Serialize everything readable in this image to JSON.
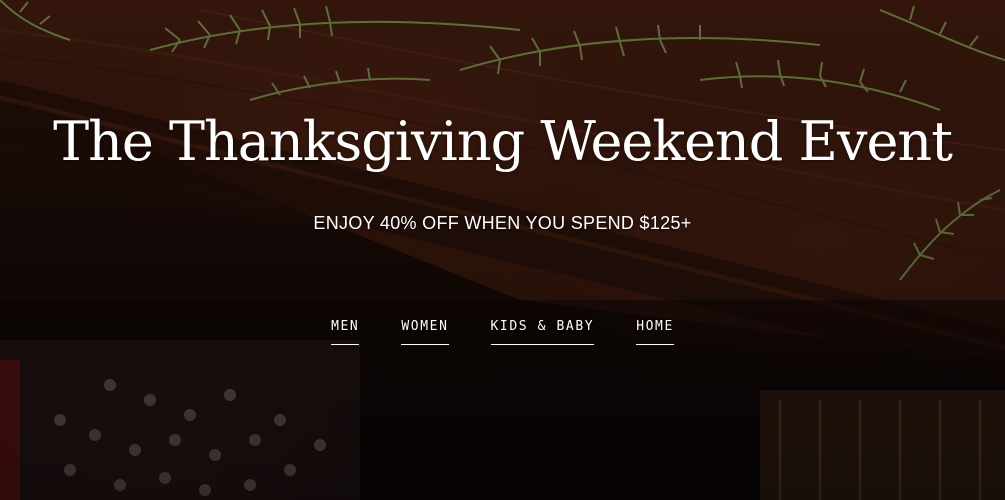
{
  "hero": {
    "headline": "The Thanksgiving Weekend Event",
    "subhead": "ENJOY 40% OFF WHEN YOU SPEND $125+",
    "nav": {
      "men": "MEN",
      "women": "WOMEN",
      "kids_baby": "KIDS & BABY",
      "home": "HOME"
    }
  }
}
